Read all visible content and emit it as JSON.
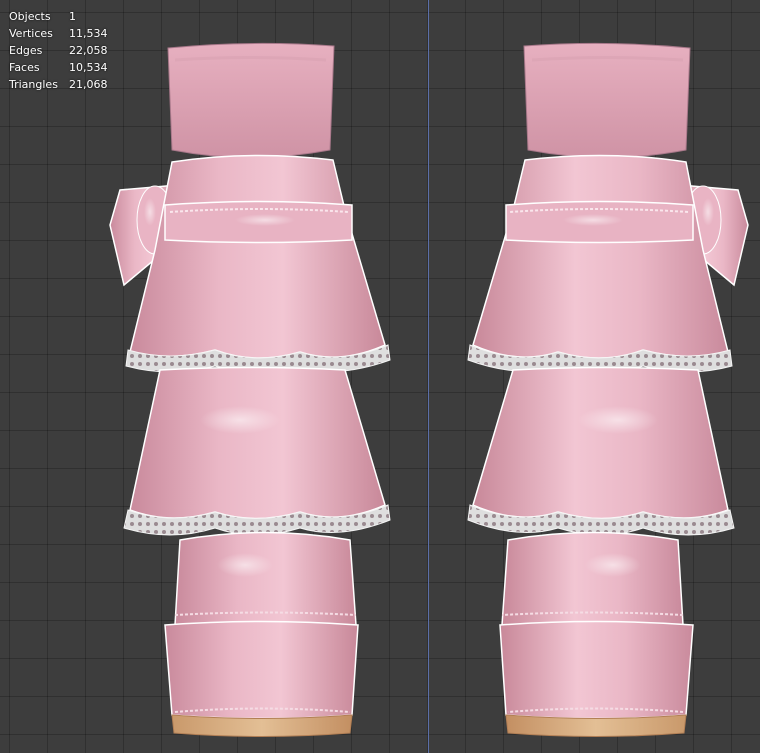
{
  "stats": [
    {
      "key": "Objects",
      "value": "1"
    },
    {
      "key": "Vertices",
      "value": "11,534"
    },
    {
      "key": "Edges",
      "value": "22,058"
    },
    {
      "key": "Faces",
      "value": "10,534"
    },
    {
      "key": "Triangles",
      "value": "21,068"
    }
  ],
  "colors": {
    "viewport_bg": "#3d3d3d",
    "grid_line": "#333333",
    "axis_line": "#5b6fa8",
    "fabric_pink": "#e7b1c1",
    "fabric_shadow": "#b9798d",
    "lace": "#eeeeee",
    "sole_wood": "#d4aa80"
  }
}
